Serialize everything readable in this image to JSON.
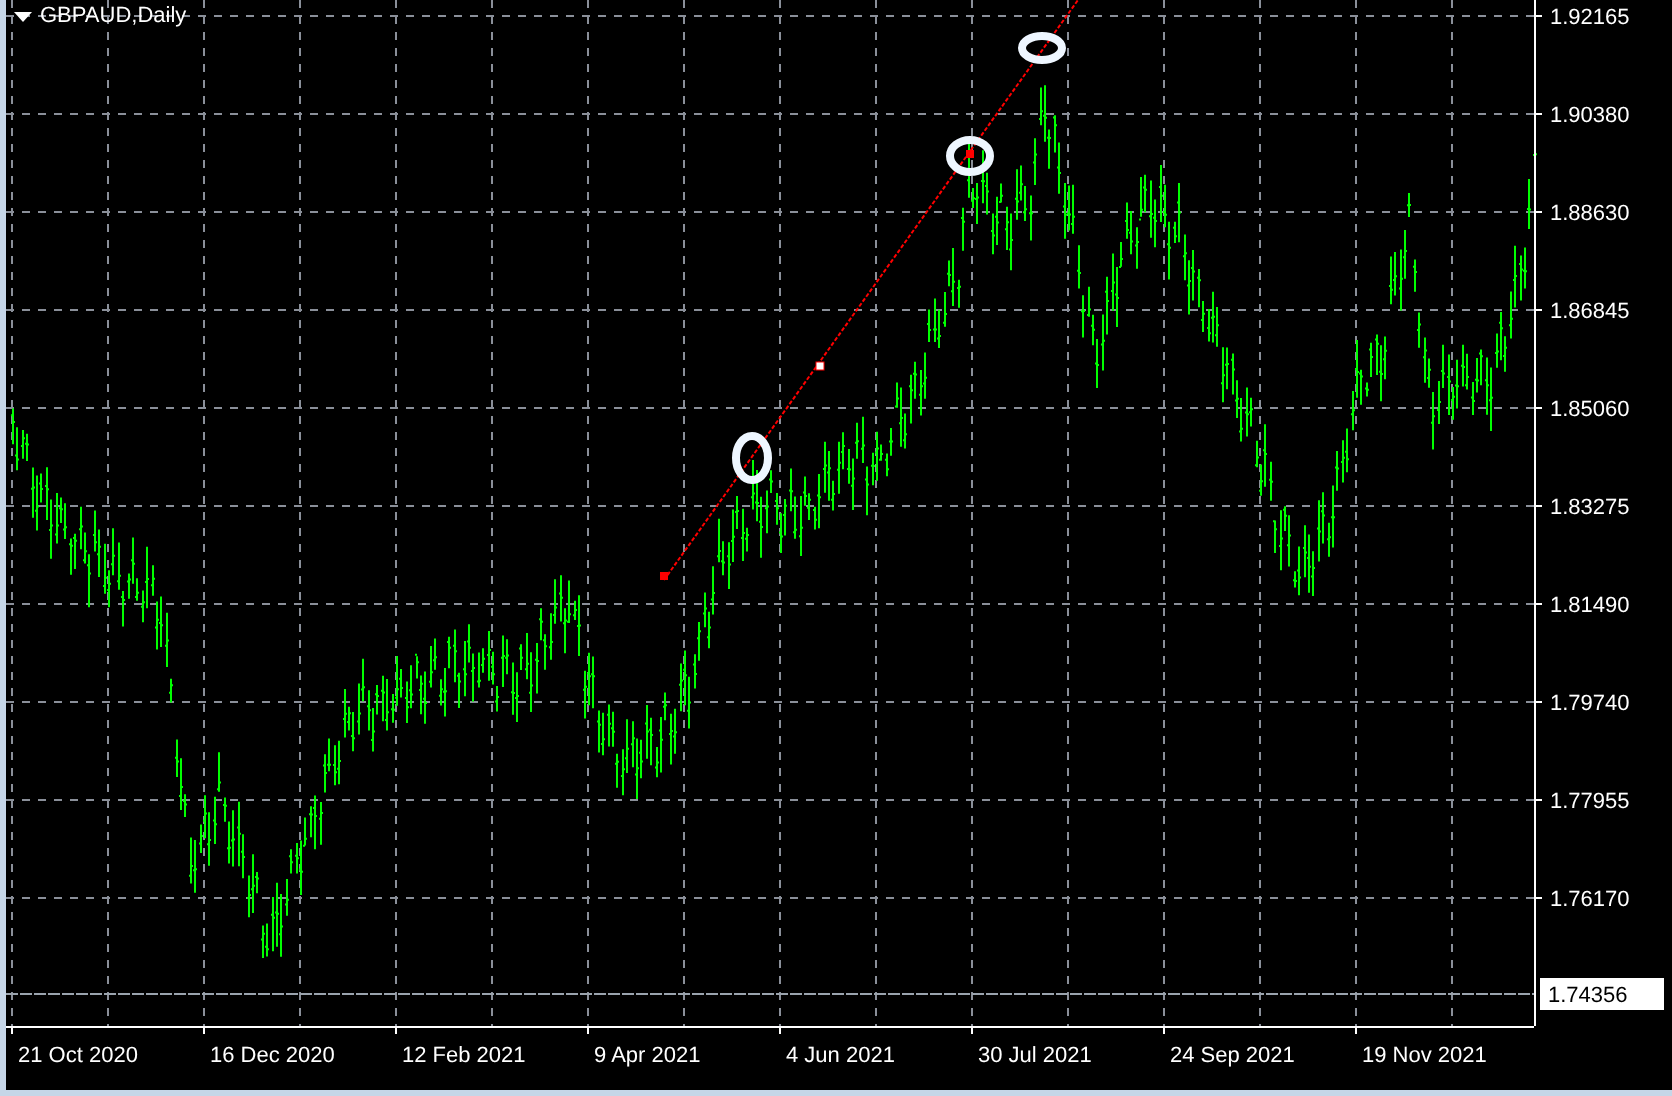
{
  "chart": {
    "title": "GBPAUD,Daily",
    "price_labels": [
      "1.92165",
      "1.90380",
      "1.88630",
      "1.86845",
      "1.85060",
      "1.83275",
      "1.81490",
      "1.79740",
      "1.77955",
      "1.76170"
    ],
    "current_price": "1.74356",
    "date_labels": [
      "21 Oct 2020",
      "16 Dec 2020",
      "12 Feb 2021",
      "9 Apr 2021",
      "4 Jun 2021",
      "30 Jul 2021",
      "24 Sep 2021",
      "19 Nov 2021"
    ]
  }
}
